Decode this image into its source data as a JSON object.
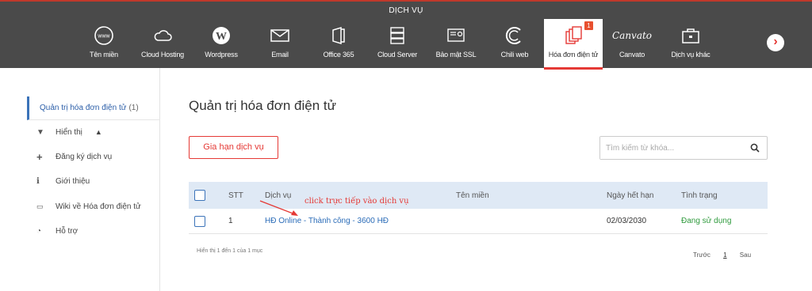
{
  "header": {
    "title": "DỊCH VỤ",
    "services": [
      {
        "label": "Tên miền",
        "icon": "www-globe-icon"
      },
      {
        "label": "Cloud Hosting",
        "icon": "cloud-icon"
      },
      {
        "label": "Wordpress",
        "icon": "wordpress-icon"
      },
      {
        "label": "Email",
        "icon": "envelope-icon"
      },
      {
        "label": "Office 365",
        "icon": "office-icon"
      },
      {
        "label": "Cloud Server",
        "icon": "server-icon"
      },
      {
        "label": "Bảo mật SSL",
        "icon": "certificate-icon"
      },
      {
        "label": "Chili web",
        "icon": "chili-icon"
      },
      {
        "label": "Hóa đơn điện tử",
        "icon": "invoice-icon",
        "badge": "1",
        "active": true
      },
      {
        "label": "Canvato",
        "icon": "canvato-logo-icon",
        "logo_text": "Canvato"
      },
      {
        "label": "Dịch vụ khác",
        "icon": "toolbox-icon"
      }
    ]
  },
  "sidebar": {
    "main_label": "Quản trị hóa đơn điện tử",
    "main_count": "(1)",
    "items": [
      {
        "label": "Hiển thị",
        "icon": "filter-icon"
      },
      {
        "label": "Đăng ký dịch vụ",
        "icon": "plus-icon"
      },
      {
        "label": "Giới thiệu",
        "icon": "info-icon"
      },
      {
        "label": "Wiki về Hóa đơn điện tử",
        "icon": "id-card-icon"
      },
      {
        "label": "Hỗ trợ",
        "icon": "support-icon"
      }
    ]
  },
  "main": {
    "title": "Quản trị hóa đơn điện tử",
    "renew_button": "Gia hạn dịch vụ",
    "search_placeholder": "Tìm kiếm từ khóa...",
    "table": {
      "headers": {
        "stt": "STT",
        "service": "Dịch vụ",
        "domain": "Tên miền",
        "expiry": "Ngày hết hạn",
        "status": "Tình trạng"
      },
      "rows": [
        {
          "stt": "1",
          "service": "HĐ Online - Thành công - 3600 HĐ",
          "domain": "",
          "expiry": "02/03/2030",
          "status": "Đang sử dụng"
        }
      ]
    },
    "footer_info": "Hiển thị 1 đến 1 của 1 mục",
    "pager": {
      "prev": "Trước",
      "current": "1",
      "next": "Sau"
    },
    "annotation": "click trực tiếp vào dịch vụ"
  },
  "colors": {
    "accent_red": "#e53935",
    "link_blue": "#2b6cb8",
    "status_green": "#2e9a3c",
    "header_bg": "#4a4a4a"
  }
}
